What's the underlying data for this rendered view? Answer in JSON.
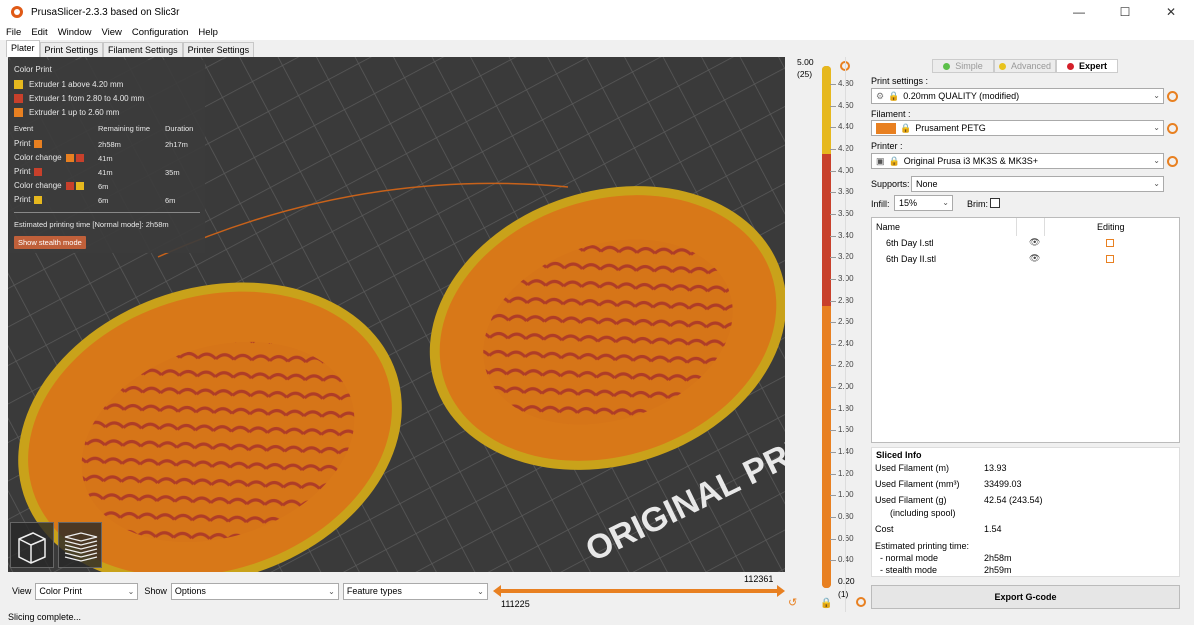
{
  "window": {
    "title": "PrusaSlicer-2.3.3 based on Slic3r",
    "minimize": "—",
    "maximize": "☐",
    "close": "✕"
  },
  "menu": [
    "File",
    "Edit",
    "Window",
    "View",
    "Configuration",
    "Help"
  ],
  "tabs": [
    "Plater",
    "Print Settings",
    "Filament Settings",
    "Printer Settings"
  ],
  "legend": {
    "title": "Color Print",
    "ranges": [
      {
        "label": "Extruder 1 above 4.20 mm",
        "color": "#e6b81e"
      },
      {
        "label": "Extruder 1 from 2.80 to 4.00 mm",
        "color": "#c8402b"
      },
      {
        "label": "Extruder 1 up to 2.60 mm",
        "color": "#e88021"
      }
    ],
    "headers": {
      "event": "Event",
      "remaining": "Remaining time",
      "duration": "Duration"
    },
    "rows": [
      {
        "event": "Print",
        "remaining": "2h58m",
        "duration": "2h17m"
      },
      {
        "event": "Color change",
        "remaining": "41m",
        "duration": ""
      },
      {
        "event": "Print",
        "remaining": "41m",
        "duration": "35m"
      },
      {
        "event": "Color change",
        "remaining": "6m",
        "duration": ""
      },
      {
        "event": "Print",
        "remaining": "6m",
        "duration": "6m"
      }
    ],
    "estimated": "Estimated printing time [Normal mode]:",
    "estimated_value": "2h58m",
    "stealth_button": "Show stealth mode"
  },
  "bed_text": "ORIGINAL PRUS",
  "bottom": {
    "view_label": "View",
    "view_value": "Color Print",
    "show_label": "Show",
    "show_value": "Options",
    "feature_value": "Feature types",
    "slider_top": "112361",
    "slider_bottom": "111225"
  },
  "vslider": {
    "top_value": "5.00",
    "top_layer": "(25)",
    "bottom_value": "0.20",
    "bottom_layer": "(1)",
    "ticks": [
      "4.80",
      "4.60",
      "4.40",
      "4.20",
      "4.00",
      "3.80",
      "3.60",
      "3.40",
      "3.20",
      "3.00",
      "2.80",
      "2.60",
      "2.40",
      "2.20",
      "2.00",
      "1.80",
      "1.60",
      "1.40",
      "1.20",
      "1.00",
      "0.80",
      "0.60",
      "0.40"
    ]
  },
  "modes": [
    {
      "label": "Simple",
      "color": "#5cc04a"
    },
    {
      "label": "Advanced",
      "color": "#e8c31e"
    },
    {
      "label": "Expert",
      "color": "#d4202a"
    }
  ],
  "settings": {
    "print_label": "Print settings :",
    "print_value": "0.20mm QUALITY (modified)",
    "filament_label": "Filament :",
    "filament_value": "Prusament PETG",
    "filament_color": "#e88021",
    "printer_label": "Printer :",
    "printer_value": "Original Prusa i3 MK3S & MK3S+",
    "supports_label": "Supports:",
    "supports_value": "None",
    "infill_label": "Infill:",
    "infill_value": "15%",
    "brim_label": "Brim:"
  },
  "objects": {
    "col_name": "Name",
    "col_editing": "Editing",
    "items": [
      "6th Day I.stl",
      "6th Day II.stl"
    ]
  },
  "sliced_info": {
    "title": "Sliced Info",
    "rows": [
      {
        "label": "Used Filament (m)",
        "value": "13.93"
      },
      {
        "label": "Used Filament (mm³)",
        "value": "33499.03"
      },
      {
        "label": "Used Filament (g)",
        "value": "42.54 (243.54)"
      },
      {
        "label": "(including spool)",
        "value": ""
      },
      {
        "label": "Cost",
        "value": "1.54"
      }
    ],
    "time_title": "Estimated printing time:",
    "normal_label": "- normal mode",
    "normal_value": "2h58m",
    "stealth_label": "- stealth mode",
    "stealth_value": "2h59m"
  },
  "export_button": "Export G-code",
  "status": "Slicing complete..."
}
